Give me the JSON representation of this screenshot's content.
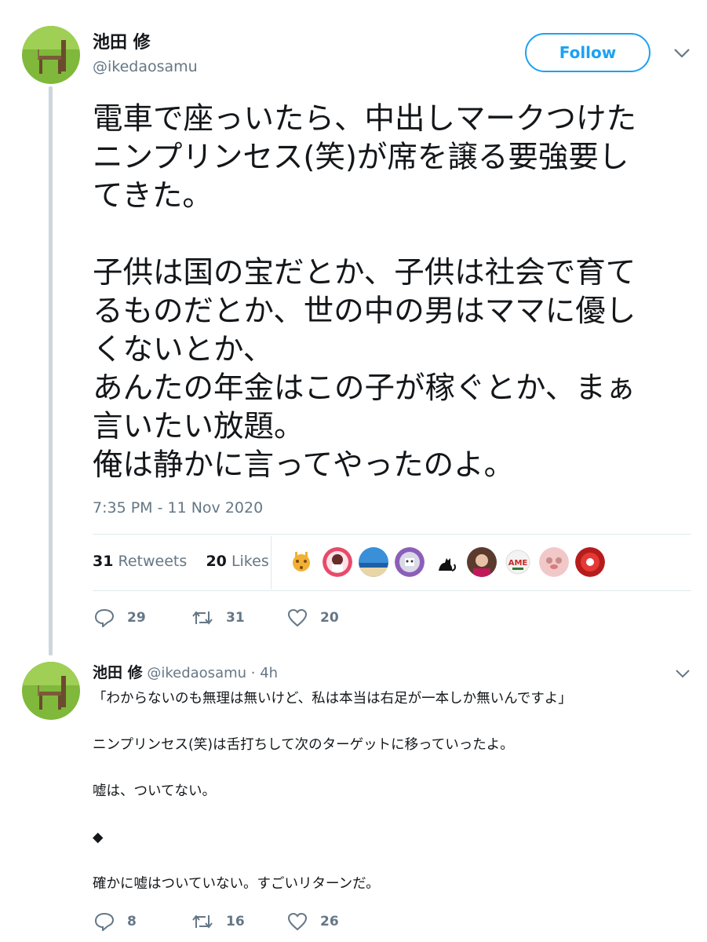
{
  "main_tweet": {
    "author_name": "池田 修",
    "author_handle": "@ikedaosamu",
    "follow_label": "Follow",
    "text": "電車で座っいたら、中出しマークつけた\nニンプリンセス(笑)が席を譲る要強要し\nてきた。\n\n子供は国の宝だとか、子供は社会で育て\nるものだとか、世の中の男はママに優し\nくないとか、\nあんたの年金はこの子が稼ぐとか、まぁ\n言いたい放題。\n俺は静かに言ってやったのよ。",
    "timestamp": "7:35 PM - 11 Nov 2020",
    "retweet_count": "31",
    "retweets_label": "Retweets",
    "like_count": "20",
    "likes_label": "Likes",
    "actions": {
      "replies": "29",
      "retweets": "31",
      "likes": "20"
    },
    "likers": [
      "giraffe-avatar",
      "anime-girl-avatar",
      "ocean-avatar",
      "robot-avatar",
      "black-cat-avatar",
      "woman-avatar",
      "ame-avatar",
      "pink-avatar",
      "red-avatar"
    ]
  },
  "reply_tweet": {
    "author_name": "池田 修",
    "author_handle": "@ikedaosamu",
    "time": "· 4h",
    "text": "「わからないのも無理は無いけど、私は本当は右足が一本しか無いんですよ」\n\nニンプリンセス(笑)は舌打ちして次のターゲットに移っていったよ。\n\n嘘は、ついてない。\n\n◆\n\n確かに嘘はついていない。すごいリターンだ。",
    "actions": {
      "replies": "8",
      "retweets": "16",
      "likes": "26"
    }
  },
  "colors": {
    "accent": "#1da1f2",
    "secondary_text": "#657786",
    "divider": "#e1e8ed"
  }
}
